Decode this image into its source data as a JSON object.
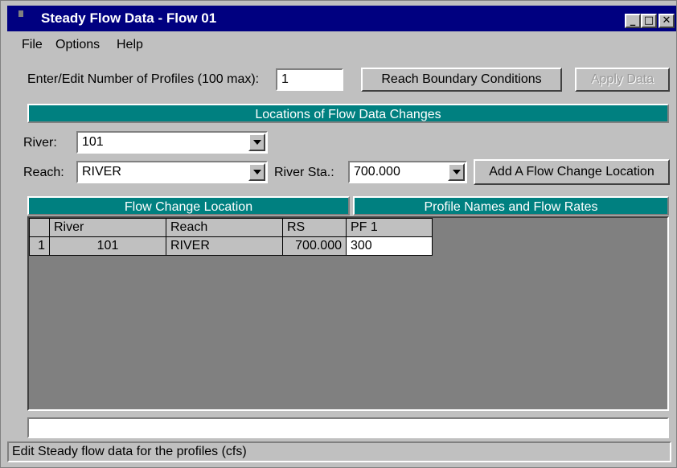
{
  "window": {
    "title": "Steady Flow Data - Flow 01",
    "minimize": "_",
    "maximize": "□",
    "close": "✕"
  },
  "menu": {
    "items": [
      "File",
      "Options",
      "Help"
    ]
  },
  "profiles": {
    "label": "Enter/Edit Number of Profiles (100 max):",
    "value": "1"
  },
  "buttons": {
    "reach_boundary": "Reach Boundary Conditions",
    "apply_data": "Apply Data",
    "add_flow_change": "Add A Flow Change Location"
  },
  "sections": {
    "locations": "Locations of Flow Data Changes",
    "flow_change_location": "Flow Change Location",
    "profile_names": "Profile Names and Flow Rates"
  },
  "selectors": {
    "river_label": "River:",
    "river_value": "101",
    "reach_label": "Reach:",
    "reach_value": "RIVER",
    "river_sta_label": "River Sta.:",
    "river_sta_value": "700.000"
  },
  "table": {
    "headers": [
      "",
      "River",
      "Reach",
      "RS",
      "PF 1"
    ],
    "rows": [
      [
        "1",
        "101",
        "RIVER",
        "700.000",
        "300"
      ]
    ]
  },
  "status_text": "Edit Steady flow data for the profiles (cfs)"
}
